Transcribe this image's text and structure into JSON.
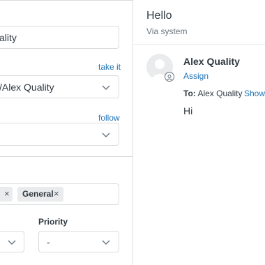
{
  "ticket_fields": {
    "requester_value": "ality",
    "assignee_take_it": "take it",
    "assignee_value": "/Alex Quality",
    "follow_link": "follow",
    "followers_value": "",
    "tags": [
      {
        "label": "",
        "remove": "×"
      },
      {
        "label": "General",
        "remove": "×"
      }
    ],
    "priority_label": "Priority",
    "type_value": "",
    "priority_value": "-"
  },
  "conversation": {
    "title": "Hello",
    "subtitle": "Via system",
    "author": "Alex Quality",
    "assign_link": "Assign",
    "to_label": "To:",
    "to_value": " Alex Quality",
    "show_link": "Show",
    "message": "Hi"
  },
  "colors": {
    "link": "#1f73b7",
    "border": "#d8dcde",
    "text": "#2f3941",
    "tag_bg": "#e9ebed"
  },
  "icons": {
    "dropdown": "chevron-down-icon",
    "avatar": "user-avatar-icon",
    "agent_badge": "agent-badge-icon"
  }
}
